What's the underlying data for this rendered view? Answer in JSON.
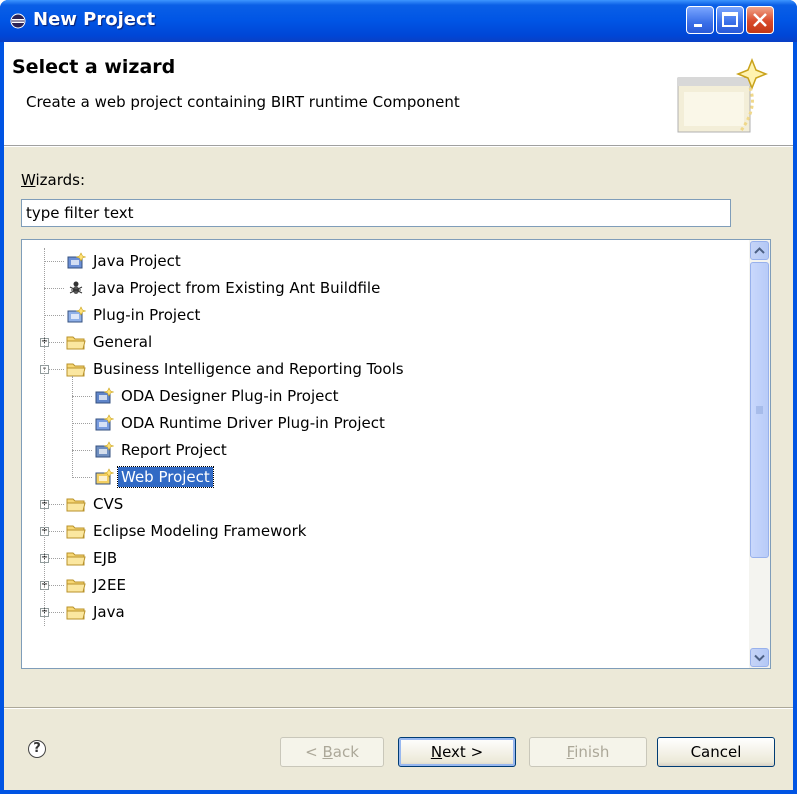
{
  "window": {
    "title": "New Project"
  },
  "header": {
    "title": "Select a wizard",
    "description": "Create a web project containing BIRT runtime Component"
  },
  "wizards": {
    "label_accel": "W",
    "label_rest": "izards:",
    "filter_value": "type filter text"
  },
  "tree": {
    "items": [
      {
        "label": "Java Project",
        "icon": "java-project-icon"
      },
      {
        "label": "Java Project from Existing Ant Buildfile",
        "icon": "ant-icon"
      },
      {
        "label": "Plug-in Project",
        "icon": "plugin-project-icon"
      },
      {
        "label": "General",
        "icon": "folder-icon",
        "expander": "+"
      },
      {
        "label": "Business Intelligence and Reporting Tools",
        "icon": "folder-icon",
        "expander": "-"
      },
      {
        "label": "ODA Designer Plug-in Project",
        "icon": "oda-designer-icon"
      },
      {
        "label": "ODA Runtime Driver Plug-in Project",
        "icon": "oda-runtime-icon"
      },
      {
        "label": "Report Project",
        "icon": "report-project-icon"
      },
      {
        "label": "Web Project",
        "icon": "web-project-icon",
        "selected": true
      },
      {
        "label": "CVS",
        "icon": "folder-icon",
        "expander": "+"
      },
      {
        "label": "Eclipse Modeling Framework",
        "icon": "folder-icon",
        "expander": "+"
      },
      {
        "label": "EJB",
        "icon": "folder-icon",
        "expander": "+"
      },
      {
        "label": "J2EE",
        "icon": "folder-icon",
        "expander": "+"
      },
      {
        "label": "Java",
        "icon": "folder-icon",
        "expander": "+"
      }
    ]
  },
  "buttons": {
    "back_pre": "< ",
    "back_accel": "B",
    "back_post": "ack",
    "next_accel": "N",
    "next_post": "ext >",
    "finish_accel": "F",
    "finish_post": "inish",
    "cancel": "Cancel"
  },
  "help": {
    "glyph": "?"
  },
  "colors": {
    "titlebar": "#0055e5",
    "selection": "#316ac5",
    "dialog_bg": "#ece9d8"
  }
}
